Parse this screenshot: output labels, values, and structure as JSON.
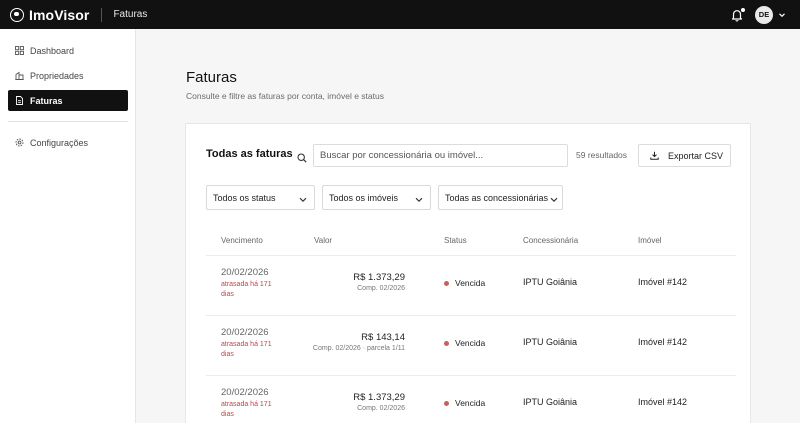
{
  "app": {
    "name": "ImoVisor",
    "section": "Faturas",
    "user_initials": "DE"
  },
  "sidebar": {
    "items": [
      {
        "label": "Dashboard",
        "icon": "grid-icon",
        "active": false
      },
      {
        "label": "Propriedades",
        "icon": "building-icon",
        "active": false
      },
      {
        "label": "Faturas",
        "icon": "document-icon",
        "active": true
      }
    ],
    "settings_label": "Configurações"
  },
  "page": {
    "title": "Faturas",
    "subtitle": "Consulte e filtre as faturas por conta, imóvel e status"
  },
  "card": {
    "title": "Todas as faturas",
    "search_placeholder": "Buscar por concessionária ou imóvel...",
    "results_count": "59 resultados",
    "export_label": "Exportar CSV",
    "filters": {
      "status": "Todos os status",
      "properties": "Todos os imóveis",
      "utilities": "Todas as concessionárias"
    }
  },
  "table": {
    "headers": {
      "due": "Vencimento",
      "amount": "Valor",
      "status": "Status",
      "utility": "Concessionária",
      "property": "Imóvel"
    },
    "rows": [
      {
        "due_date": "20/02/2026",
        "overdue_note": "atrasada há 171 dias",
        "amount": "R$ 1.373,29",
        "competence": "Comp. 02/2026",
        "status": "Vencida",
        "utility": "IPTU Goiânia",
        "property": "Imóvel #142"
      },
      {
        "due_date": "20/02/2026",
        "overdue_note": "atrasada há 171 dias",
        "amount": "R$ 143,14",
        "competence": "Comp. 02/2026 · parcela 1/11",
        "status": "Vencida",
        "utility": "IPTU Goiânia",
        "property": "Imóvel #142"
      },
      {
        "due_date": "20/02/2026",
        "overdue_note": "atrasada há 171 dias",
        "amount": "R$ 1.373,29",
        "competence": "Comp. 02/2026",
        "status": "Vencida",
        "utility": "IPTU Goiânia",
        "property": "Imóvel #142"
      }
    ]
  },
  "colors": {
    "topbar": "#111111",
    "overdue": "#c24444",
    "status_dot": "#c8615d"
  }
}
